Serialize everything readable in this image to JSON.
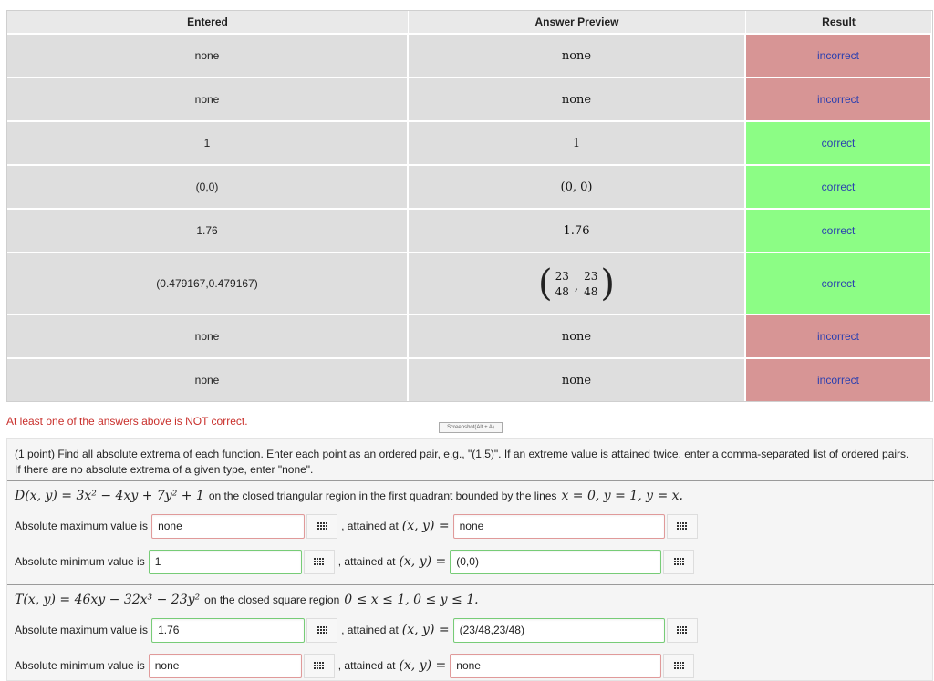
{
  "results_table": {
    "headers": [
      "Entered",
      "Answer Preview",
      "Result"
    ],
    "rows": [
      {
        "entered": "none",
        "preview": "none",
        "result": "incorrect"
      },
      {
        "entered": "none",
        "preview": "none",
        "result": "incorrect"
      },
      {
        "entered": "1",
        "preview": "1",
        "result": "correct"
      },
      {
        "entered": "(0,0)",
        "preview": "(0, 0)",
        "result": "correct"
      },
      {
        "entered": "1.76",
        "preview": "1.76",
        "result": "correct"
      },
      {
        "entered": "(0.479167,0.479167)",
        "preview_fraction": {
          "num1": "23",
          "den1": "48",
          "num2": "23",
          "den2": "48"
        },
        "result": "correct"
      },
      {
        "entered": "none",
        "preview": "none",
        "result": "incorrect"
      },
      {
        "entered": "none",
        "preview": "none",
        "result": "incorrect"
      }
    ],
    "colors": {
      "correct": "#8cfd85",
      "incorrect": "#d79595",
      "result_text": "#2a3fb0"
    }
  },
  "status_message": "At least one of the answers above is NOT correct.",
  "screenshot_tooltip": "Screenshot(Alt + A)",
  "problem": {
    "intro": "(1 point) Find all absolute extrema of each function. Enter each point as an ordered pair, e.g., \"(1,5)\". If an extreme value is attained twice, enter a comma-separated list of ordered pairs. If there are no absolute extrema of a given type, enter \"none\".",
    "part1": {
      "function": "D(x, y) = 3x² − 4xy + 7y² + 1",
      "region_text": "on the closed triangular region in the first quadrant bounded by the lines",
      "region_math": "x = 0, y = 1, y = x.",
      "max_label": "Absolute maximum value is",
      "max_value": "none",
      "max_at_label": ", attained at",
      "max_at_math": "(x, y) =",
      "max_at_value": "none",
      "min_label": "Absolute minimum value is",
      "min_value": "1",
      "min_at_label": ", attained at",
      "min_at_math": "(x, y) =",
      "min_at_value": "(0,0)"
    },
    "part2": {
      "function": "T(x, y) = 46xy − 32x³ − 23y²",
      "region_text": "on the closed square region",
      "region_math": "0 ≤ x ≤ 1, 0 ≤ y ≤ 1.",
      "max_label": "Absolute maximum value is",
      "max_value": "1.76",
      "max_at_label": ", attained at",
      "max_at_math": "(x, y) =",
      "max_at_value": "(23/48,23/48)",
      "min_label": "Absolute minimum value is",
      "min_value": "none",
      "min_at_label": ", attained at",
      "min_at_math": "(x, y) =",
      "min_at_value": "none"
    }
  }
}
